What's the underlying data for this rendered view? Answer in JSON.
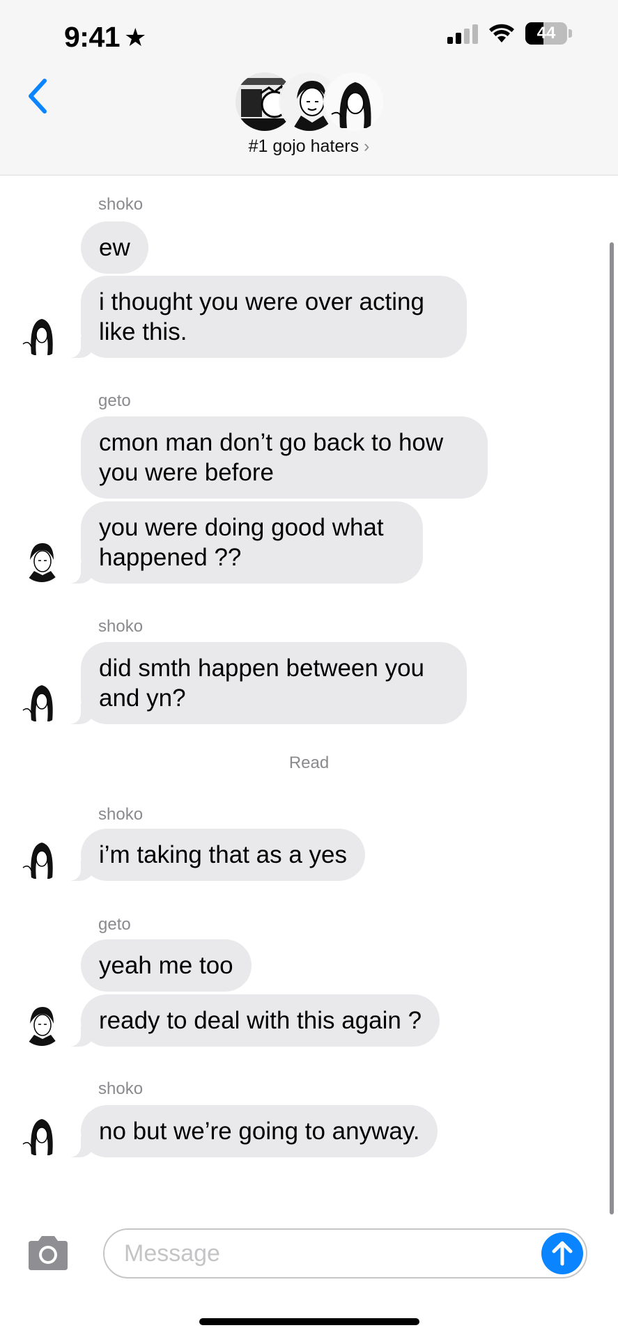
{
  "status_bar": {
    "time": "9:41",
    "battery": "44"
  },
  "header": {
    "group_name": "#1 gojo haters",
    "group_chevron": "›"
  },
  "messages": [
    {
      "sender": "shoko",
      "text": "ew"
    },
    {
      "text": "i thought you were over acting like this."
    },
    {
      "sender": "geto",
      "text": "cmon man don’t go back to how you were before"
    },
    {
      "text": "you were doing good what happened ??"
    },
    {
      "sender": "shoko",
      "text": "did smth happen between you and yn?"
    },
    {
      "sender": "shoko",
      "text": "i’m taking that as a yes"
    },
    {
      "sender": "geto",
      "text": "yeah me too"
    },
    {
      "text": "ready to deal with this again ?"
    },
    {
      "sender": "shoko",
      "text": "no but we’re going to anyway."
    }
  ],
  "read_receipt": "Read",
  "composer": {
    "placeholder": "Message"
  },
  "colors": {
    "accent": "#0a84ff",
    "bubble": "#e9e9eb",
    "header_bg": "#f6f6f6"
  },
  "icons": [
    "star-icon",
    "signal-icon",
    "wifi-icon",
    "battery-icon",
    "back-chevron-icon",
    "camera-icon",
    "send-arrow-icon"
  ]
}
